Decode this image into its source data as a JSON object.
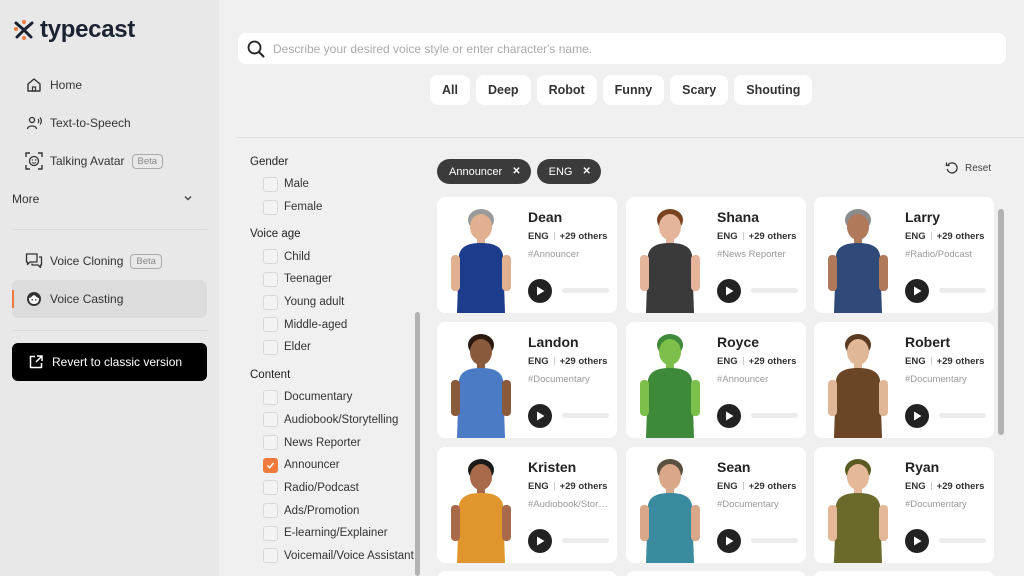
{
  "sidebar": {
    "logo_text": "typecast",
    "nav_top": [
      {
        "label": "Home",
        "icon": "home-icon"
      },
      {
        "label": "Text-to-Speech",
        "icon": "speaker-person-icon"
      },
      {
        "label": "Talking Avatar",
        "icon": "face-scan-icon",
        "badge": "Beta"
      }
    ],
    "more_label": "More",
    "nav_bottom": [
      {
        "label": "Voice Cloning",
        "icon": "chat-bubbles-icon",
        "badge": "Beta"
      },
      {
        "label": "Voice Casting",
        "icon": "avatar-face-icon",
        "active": true
      }
    ],
    "revert_label": "Revert to classic version"
  },
  "search": {
    "placeholder": "Describe your desired voice style or enter character's name.",
    "value": ""
  },
  "style_chips": [
    "All",
    "Deep",
    "Robot",
    "Funny",
    "Scary",
    "Shouting"
  ],
  "filters": {
    "groups": [
      {
        "title": "Gender",
        "options": [
          {
            "label": "Male",
            "checked": false
          },
          {
            "label": "Female",
            "checked": false
          }
        ]
      },
      {
        "title": "Voice age",
        "options": [
          {
            "label": "Child",
            "checked": false
          },
          {
            "label": "Teenager",
            "checked": false
          },
          {
            "label": "Young adult",
            "checked": false
          },
          {
            "label": "Middle-aged",
            "checked": false
          },
          {
            "label": "Elder",
            "checked": false
          }
        ]
      },
      {
        "title": "Content",
        "options": [
          {
            "label": "Documentary",
            "checked": false
          },
          {
            "label": "Audiobook/Storytelling",
            "checked": false
          },
          {
            "label": "News Reporter",
            "checked": false
          },
          {
            "label": "Announcer",
            "checked": true
          },
          {
            "label": "Radio/Podcast",
            "checked": false
          },
          {
            "label": "Ads/Promotion",
            "checked": false
          },
          {
            "label": "E-learning/Explainer",
            "checked": false
          },
          {
            "label": "Voicemail/Voice Assistant",
            "checked": false
          }
        ]
      }
    ]
  },
  "active_tags": [
    "Announcer",
    "ENG"
  ],
  "reset_label": "Reset",
  "characters": [
    {
      "name": "Dean",
      "lang": "ENG",
      "others": "+29 others",
      "tag": "#Announcer",
      "colors": {
        "body": "#1e3c8c",
        "skin": "#e0b090",
        "hair": "#9a9a9a"
      }
    },
    {
      "name": "Shana",
      "lang": "ENG",
      "others": "+29 others",
      "tag": "#News Reporter",
      "colors": {
        "body": "#3a3a3a",
        "skin": "#e4b59a",
        "hair": "#7a4320"
      }
    },
    {
      "name": "Larry",
      "lang": "ENG",
      "others": "+29 others",
      "tag": "#Radio/Podcast",
      "colors": {
        "body": "#2f4a78",
        "skin": "#b07a5a",
        "hair": "#8c8c8c"
      }
    },
    {
      "name": "Landon",
      "lang": "ENG",
      "others": "+29 others",
      "tag": "#Documentary",
      "colors": {
        "body": "#4a7bc4",
        "skin": "#8a5a3c",
        "hair": "#2a1a10"
      }
    },
    {
      "name": "Royce",
      "lang": "ENG",
      "others": "+29 others",
      "tag": "#Announcer",
      "colors": {
        "body": "#3e8a3a",
        "skin": "#7cbf4a",
        "hair": "#3e8a3a"
      }
    },
    {
      "name": "Robert",
      "lang": "ENG",
      "others": "+29 others",
      "tag": "#Documentary",
      "colors": {
        "body": "#6a4526",
        "skin": "#e0b898",
        "hair": "#5a3a20"
      }
    },
    {
      "name": "Kristen",
      "lang": "ENG",
      "others": "+29 others",
      "tag": "#Audiobook/Storytelling",
      "colors": {
        "body": "#e0962c",
        "skin": "#a86a4a",
        "hair": "#1a1a1a"
      }
    },
    {
      "name": "Sean",
      "lang": "ENG",
      "others": "+29 others",
      "tag": "#Documentary",
      "colors": {
        "body": "#3a8aa0",
        "skin": "#d8a888",
        "hair": "#5a5040"
      }
    },
    {
      "name": "Ryan",
      "lang": "ENG",
      "others": "+29 others",
      "tag": "#Documentary",
      "colors": {
        "body": "#6b6a2c",
        "skin": "#e4b898",
        "hair": "#5a5a22"
      }
    }
  ],
  "theme": {
    "accent": "#f07a3e",
    "dark": "#222222"
  }
}
